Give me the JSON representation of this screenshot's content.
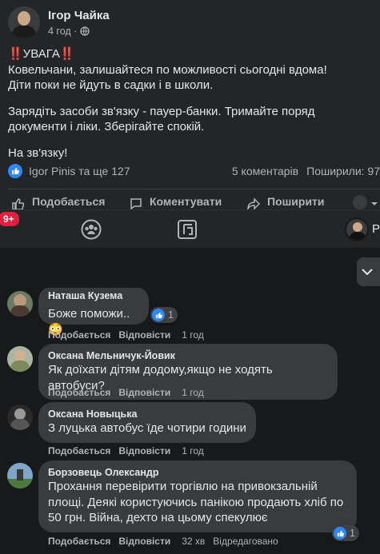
{
  "post": {
    "author_name": "Ігор Чайка",
    "time": "4 год ·",
    "lines": {
      "title": "‼️УВАГА‼️",
      "p1_line2": "Ковельчани, залишайтеся по можливості сьогодні вдома!",
      "p1_line3": "Діти поки не йдуть в садки і в школи.",
      "p2_line1": "Зарядіть засоби зв'язку - пауер-банки.  Тримайте поряд",
      "p2_line2": "документи і ліки. Зберігайте спокій.",
      "p3": "На зв'язку!"
    },
    "reactors": "Igor Pinis та ще 127",
    "comments_count": "5 коментарів",
    "shares": "Поширили: 97",
    "actions": {
      "like": "Подобається",
      "comment": "Коментувати",
      "share": "Поширити"
    }
  },
  "nav": {
    "badge": "9+",
    "profile_label": "Ро"
  },
  "comments": [
    {
      "name": "Наташа Кузема",
      "text": "Боже поможи..😳",
      "like": "Подобається",
      "reply": "Відповісти",
      "time": "1 год",
      "reactions": "1"
    },
    {
      "name": "Оксана Мельничук-Йовик",
      "text": "Як доїхати дітям додому,якщо не ходять автобуси?",
      "like": "Подобається",
      "reply": "Відповісти",
      "time": "1 год"
    },
    {
      "name": "Оксана Новыцька",
      "text": "З луцька автобус їде чотири години",
      "like": "Подобається",
      "reply": "Відповісти",
      "time": "1 год"
    },
    {
      "name": "Борзовець Олександр",
      "text_line1": "Прохання перевірити торгівлю на привокзальній",
      "text_line2": "площі. Деякі користуючись панікою продають хліб по",
      "text_line3": "50 грн. Війна, дехто на цьому спекулює",
      "like": "Подобається",
      "reply": "Відповісти",
      "time": "32 хв",
      "edited": "Відредаговано",
      "reactions": "1"
    }
  ],
  "colors": {
    "background": "#18191a",
    "card": "#242526",
    "bubble": "#3a3b3c",
    "accent": "#2d88ff",
    "badge": "#e41e3f"
  }
}
